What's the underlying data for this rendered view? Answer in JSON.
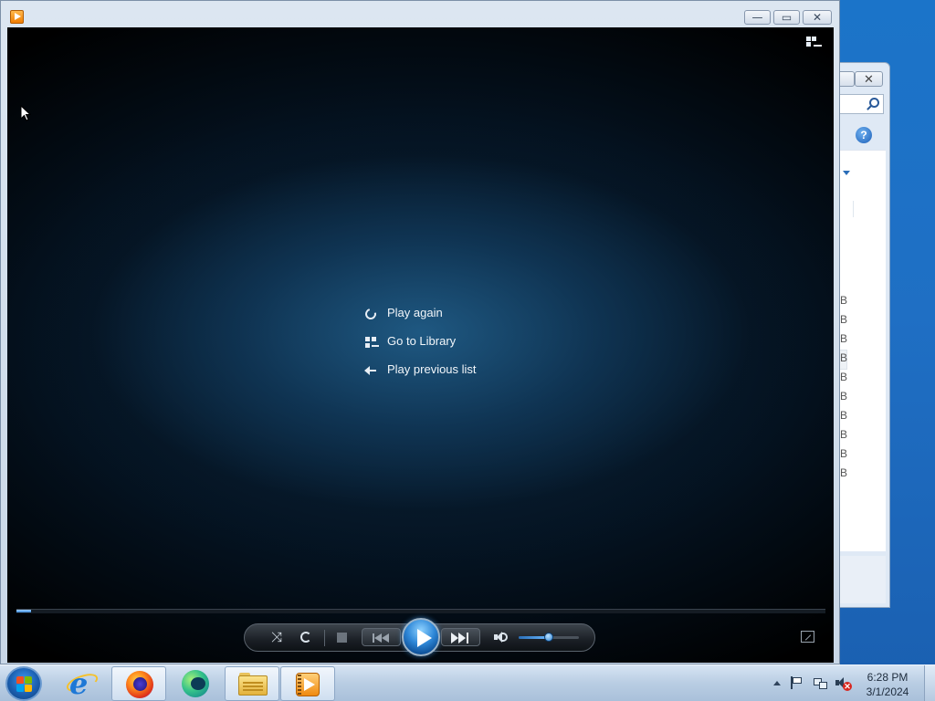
{
  "background_window": {
    "close_label": "✕",
    "help_label": "?",
    "rows": [
      "B",
      "B",
      "B",
      "B",
      "B",
      "B",
      "B",
      "B",
      "B",
      "B"
    ]
  },
  "player": {
    "min_label": "—",
    "max_label": "▭",
    "close_label": "✕",
    "menu": [
      {
        "label": "Play again",
        "icon": "replay-icon"
      },
      {
        "label": "Go to Library",
        "icon": "library-icon"
      },
      {
        "label": "Play previous list",
        "icon": "back-arrow-icon"
      }
    ],
    "seek_progress": 0.018,
    "volume_level": 0.5,
    "shuffle_glyph": "⤨"
  },
  "taskbar": {
    "apps": [
      {
        "name": "internet-explorer",
        "active": false
      },
      {
        "name": "firefox",
        "active": false
      },
      {
        "name": "browser",
        "active": false
      },
      {
        "name": "file-explorer",
        "active": true
      },
      {
        "name": "windows-media-player",
        "active": true
      }
    ],
    "clock": {
      "time": "6:28 PM",
      "date": "3/1/2024"
    },
    "volume_muted_glyph": "✕"
  },
  "colors": {
    "desktop": "#1f6fc4",
    "play_button": "#2f88d8",
    "text": "#f2f6fa"
  }
}
